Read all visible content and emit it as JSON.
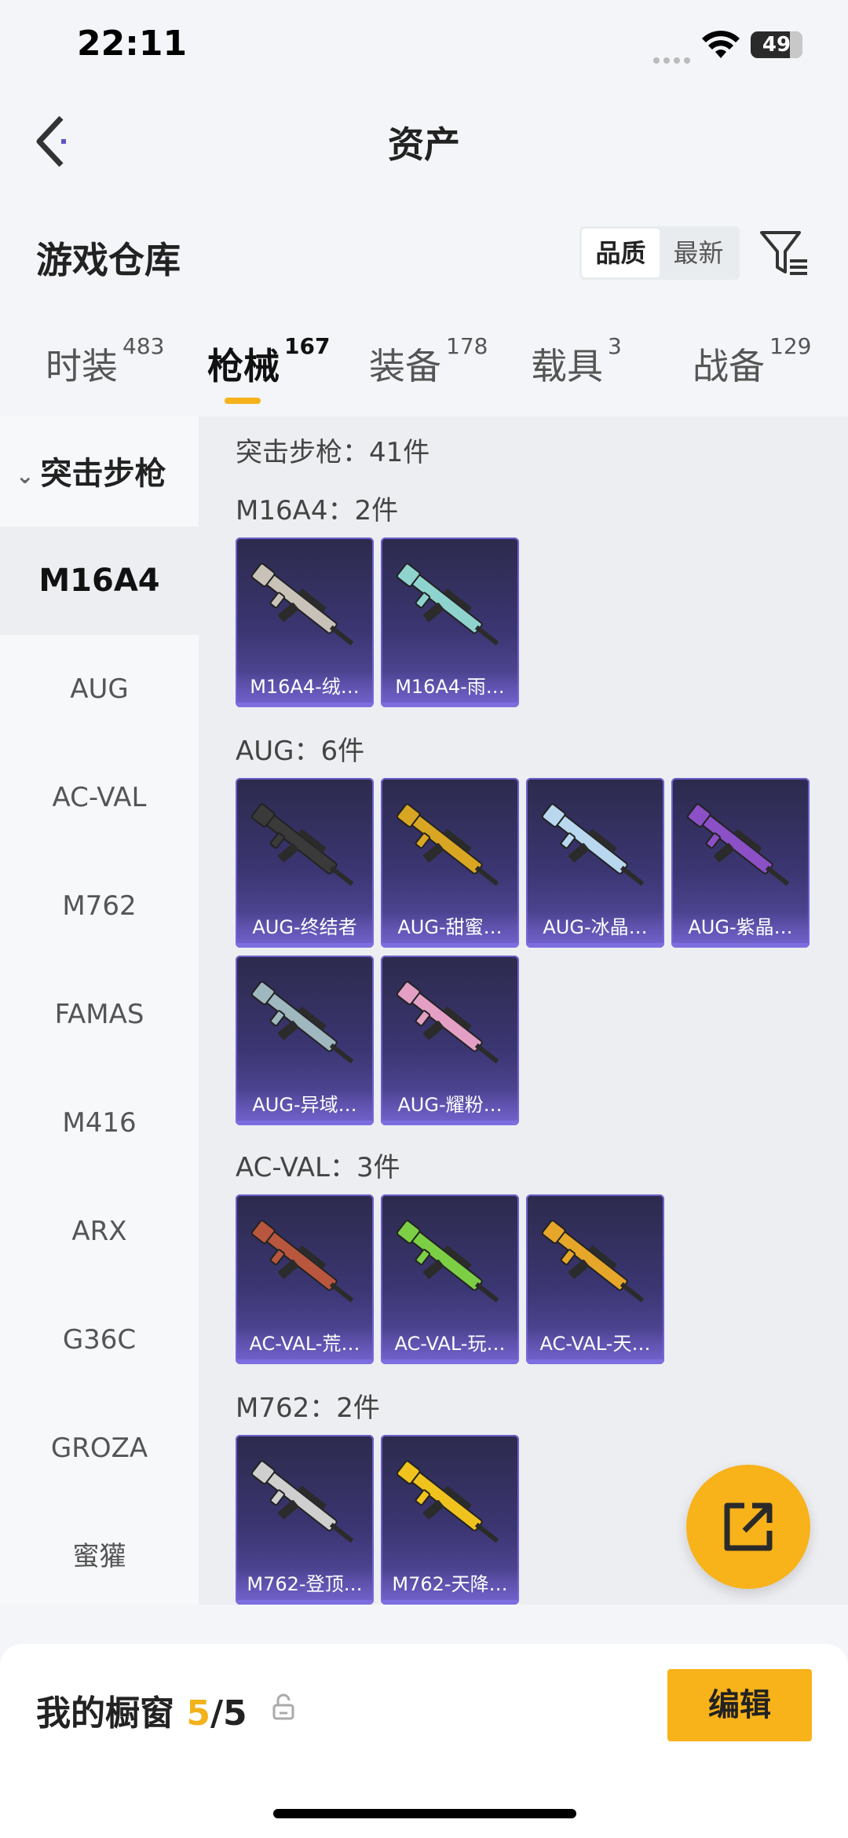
{
  "status": {
    "time": "22:11",
    "battery": "49"
  },
  "nav": {
    "title": "资产"
  },
  "section": {
    "title": "游戏仓库",
    "sort_options": [
      "品质",
      "最新"
    ],
    "sort_active": "品质"
  },
  "tabs": [
    {
      "label": "时装",
      "count": "483"
    },
    {
      "label": "枪械",
      "count": "167"
    },
    {
      "label": "装备",
      "count": "178"
    },
    {
      "label": "载具",
      "count": "3"
    },
    {
      "label": "战备",
      "count": "129"
    }
  ],
  "active_tab": "枪械",
  "sidebar": {
    "group": "突击步枪",
    "items": [
      "M16A4",
      "AUG",
      "AC-VAL",
      "M762",
      "FAMAS",
      "M416",
      "ARX",
      "G36C",
      "GROZA",
      "蜜獾"
    ],
    "active": "M16A4"
  },
  "content": {
    "total": "突击步枪：41件",
    "groups": [
      {
        "label": "M16A4：2件",
        "items": [
          {
            "name": "M16A4-绒…",
            "color": "#c9c2b8"
          },
          {
            "name": "M16A4-雨…",
            "color": "#8fd3cf"
          }
        ]
      },
      {
        "label": "AUG：6件",
        "items": [
          {
            "name": "AUG-终结者",
            "color": "#3a3a3a"
          },
          {
            "name": "AUG-甜蜜…",
            "color": "#d8a623"
          },
          {
            "name": "AUG-冰晶…",
            "color": "#b9d8f0"
          },
          {
            "name": "AUG-紫晶…",
            "color": "#8b4fc6"
          },
          {
            "name": "AUG-异域…",
            "color": "#9fb7bf"
          },
          {
            "name": "AUG-耀粉…",
            "color": "#e3a0c4"
          }
        ]
      },
      {
        "label": "AC-VAL：3件",
        "items": [
          {
            "name": "AC-VAL-荒…",
            "color": "#b8573e"
          },
          {
            "name": "AC-VAL-玩…",
            "color": "#7ccf45"
          },
          {
            "name": "AC-VAL-天…",
            "color": "#e5a62a"
          }
        ]
      },
      {
        "label": "M762：2件",
        "items": [
          {
            "name": "M762-登顶…",
            "color": "#cfcfcf"
          },
          {
            "name": "M762-天降…",
            "color": "#f0c21e"
          }
        ]
      }
    ]
  },
  "bottom": {
    "label": "我的橱窗",
    "count": "5",
    "max": "/5",
    "edit": "编辑"
  }
}
